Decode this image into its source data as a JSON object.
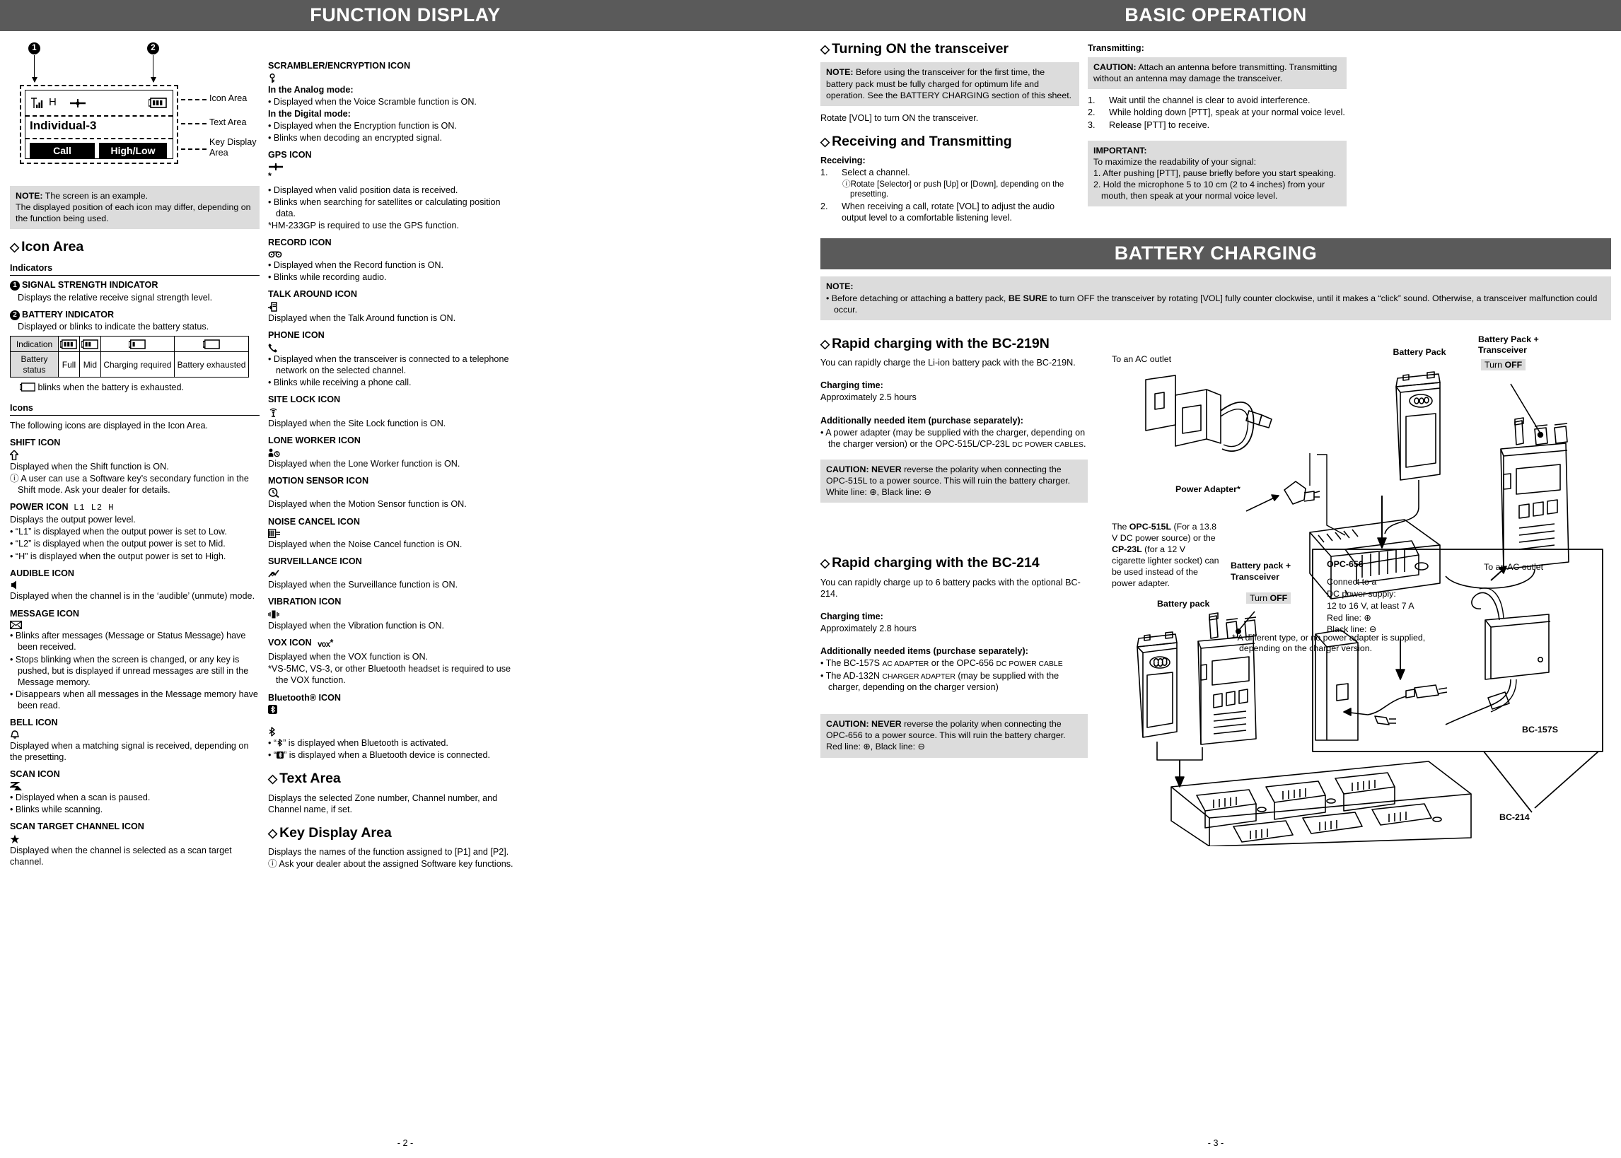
{
  "left_page": {
    "banner": "FUNCTION DISPLAY",
    "page_number": "- 2 -",
    "figure": {
      "callout_1": "1",
      "callout_2": "2",
      "lcd_power": "H",
      "lcd_text": "Individual-3",
      "key_left": "Call",
      "key_right": "High/Low",
      "label_icon_area": "Icon Area",
      "label_text_area": "Text Area",
      "label_key_area": "Key Display Area"
    },
    "figure_note": {
      "bold": "NOTE:",
      "line1": " The screen is an example.",
      "line2": "The displayed position of each icon may differ, depending on the function being used."
    },
    "icon_area": {
      "heading": "Icon Area",
      "indicators_heading": "Indicators",
      "indicator_1": {
        "num": "1",
        "title": "SIGNAL STRENGTH INDICATOR",
        "desc": "Displays the relative receive signal strength level."
      },
      "indicator_2": {
        "num": "2",
        "title": "BATTERY INDICATOR",
        "desc": "Displayed or blinks to indicate the battery status."
      },
      "battery_table": {
        "row1_header": "Indication",
        "row2_header": "Battery status",
        "statuses": [
          "Full",
          "Mid",
          "Charging required",
          "Battery exhausted"
        ]
      },
      "battery_note": "blinks when the battery is exhausted."
    },
    "icons_section": {
      "heading": "Icons",
      "intro": "The following icons are displayed in the Icon Area.",
      "items": [
        {
          "title": "SHIFT ICON",
          "lines": [
            "Displayed when the Shift function is ON."
          ],
          "info": "A user can use a Software key’s secondary function in the Shift mode. Ask your dealer for details."
        },
        {
          "title": "POWER ICON",
          "glyph_text": "L1 L2 H",
          "lines": [
            "Displays the output power level.",
            "• “L1” is displayed when the output power is set to Low.",
            "• “L2” is displayed when the output power is set to Mid.",
            "• “H” is displayed when the output power is set to High."
          ]
        },
        {
          "title": "AUDIBLE ICON",
          "lines": [
            "Displayed when the channel is in the ‘audible’ (unmute) mode."
          ]
        },
        {
          "title": "MESSAGE ICON",
          "lines": [
            "• Blinks after messages (Message or Status Message) have been received.",
            "• Stops blinking when the screen is changed, or any key is pushed, but is displayed if unread messages are still in the Message memory.",
            "• Disappears when all messages in the Message memory have been read."
          ]
        },
        {
          "title": "BELL ICON",
          "lines": [
            "Displayed when a matching signal is received, depending on the presetting."
          ]
        },
        {
          "title": "SCAN ICON",
          "lines": [
            "• Displayed when a scan is paused.",
            "• Blinks while scanning."
          ]
        },
        {
          "title": "SCAN TARGET CHANNEL ICON",
          "lines": [
            "Displayed when the channel is selected as a scan target channel."
          ]
        }
      ]
    },
    "col2_items": [
      {
        "title": "SCRAMBLER/ENCRYPTION ICON",
        "lines": [
          "B:In the Analog mode:",
          "• Displayed when the Voice Scramble function is ON.",
          "B:In the Digital mode:",
          "• Displayed when the Encryption function is ON.",
          "• Blinks when decoding an encrypted signal."
        ]
      },
      {
        "title": "GPS ICON",
        "star": "*",
        "lines": [
          "• Displayed when valid position data is received.",
          "• Blinks when searching for satellites or calculating position data.",
          "*HM-233GP is required to use the GPS function."
        ]
      },
      {
        "title": "RECORD ICON",
        "lines": [
          "• Displayed when the Record function is ON.",
          "• Blinks while recording audio."
        ]
      },
      {
        "title": "TALK AROUND ICON",
        "lines": [
          "Displayed when the Talk Around function is ON."
        ]
      },
      {
        "title": "PHONE ICON",
        "lines": [
          "• Displayed when the transceiver is connected to a telephone network on the selected channel.",
          "• Blinks while receiving a phone call."
        ]
      },
      {
        "title": "SITE LOCK ICON",
        "lines": [
          "Displayed when the Site Lock function is ON."
        ]
      },
      {
        "title": "LONE WORKER ICON",
        "lines": [
          "Displayed when the Lone Worker function is ON."
        ]
      },
      {
        "title": "MOTION SENSOR ICON",
        "lines": [
          "Displayed when the Motion Sensor function is ON."
        ]
      },
      {
        "title": "NOISE CANCEL ICON",
        "lines": [
          "Displayed when the Noise Cancel function is ON."
        ]
      },
      {
        "title": "SURVEILLANCE ICON",
        "lines": [
          "Displayed when the Surveillance function is ON."
        ]
      },
      {
        "title": "VIBRATION ICON",
        "lines": [
          "Displayed when the Vibration function is ON."
        ]
      },
      {
        "title": "VOX ICON",
        "star": "*",
        "lines": [
          "Displayed when the VOX function is ON.",
          "*VS-5MC, VS-3, or other Bluetooth headset is required to use the VOX function."
        ]
      },
      {
        "title": "Bluetooth® ICON",
        "lines": [
          "• “ ” is displayed when Bluetooth is activated.",
          "• “ ” is displayed when a Bluetooth device is connected."
        ]
      }
    ],
    "text_area": {
      "heading": "Text Area",
      "desc": "Displays the selected Zone number, Channel number, and Channel name, if set."
    },
    "key_display_area": {
      "heading": "Key Display Area",
      "desc": "Displays the names of the function assigned to [P1] and [P2].",
      "info": "Ask your dealer about the assigned Software key functions."
    }
  },
  "right_page": {
    "banner_basic": "BASIC OPERATION",
    "banner_battery": "BATTERY CHARGING",
    "page_number": "- 3 -",
    "turning_on": {
      "heading": "Turning ON the transceiver",
      "note_bold": "NOTE:",
      "note_text": " Before using the transceiver for the first time, the battery pack must be fully charged for optimum life and operation. See the BATTERY CHARGING section of this sheet.",
      "body": "Rotate [VOL] to turn ON the transceiver."
    },
    "receiving_transmitting": {
      "heading": "Receiving and Transmitting",
      "receiving_label": "Receiving:",
      "steps": [
        {
          "n": "1.",
          "text": "Select a channel."
        },
        {
          "n": "2.",
          "text": "When receiving a call, rotate [VOL] to adjust the audio output level to a comfortable listening level."
        }
      ],
      "step1_info": "Rotate [Selector] or push [Up] or [Down], depending on the presetting."
    },
    "transmitting": {
      "label": "Transmitting:",
      "caution_bold": "CAUTION:",
      "caution_text": " Attach an antenna before transmitting. Transmitting without an antenna may damage the transceiver.",
      "steps": [
        {
          "n": "1.",
          "text": "Wait until the channel is clear to avoid interference."
        },
        {
          "n": "2.",
          "text": "While holding down [PTT], speak at your normal voice level."
        },
        {
          "n": "3.",
          "text": "Release [PTT] to receive."
        }
      ],
      "important_title": "IMPORTANT:",
      "important_intro": "To maximize the readability of your signal:",
      "important_items": [
        "1. After pushing [PTT], pause briefly before you start speaking.",
        "2. Hold the microphone 5 to 10 cm (2 to 4 inches) from your mouth, then speak at your normal voice level."
      ]
    },
    "battery_note": {
      "title": "NOTE:",
      "text_a": "• Before detaching or attaching a battery pack, ",
      "text_b": "BE SURE",
      "text_c": " to turn OFF the transceiver by rotating [VOL] fully counter clockwise, until it makes a “click” sound. Otherwise, a transceiver malfunction could occur."
    },
    "bc219n": {
      "heading": "Rapid charging with the BC-219N",
      "body": "You can rapidly charge the Li-ion battery pack with the BC-219N.",
      "charging_time_label": "Charging time:",
      "charging_time": "Approximately 2.5 hours",
      "needed_label": "Additionally needed item (purchase separately):",
      "needed_text_1": "• A power adapter (may be supplied with the charger, depending on the charger version) or the OPC-515L/CP-23L ",
      "needed_text_2": "DC POWER CABLES",
      "needed_text_3": ".",
      "caution_bold": "CAUTION: NEVER",
      "caution_text": " reverse the polarity when connecting the OPC-515L to a power source. This will ruin the battery charger.",
      "polarity": "White line: ⊕, Black line: ⊖"
    },
    "bc219n_figure": {
      "ac_outlet": "To an AC outlet",
      "power_adapter": "Power Adapter*",
      "battery_pack": "Battery Pack",
      "battery_pack_transceiver": "Battery Pack + Transceiver",
      "turn_off_pre": "Turn ",
      "turn_off_bold": "OFF",
      "opc_note_1": "The ",
      "opc_note_b1": "OPC-515L",
      "opc_note_2": " (For a 13.8 V DC power source) or the ",
      "opc_note_b2": "CP-23L",
      "opc_note_3": " (for a 12 V cigarette lighter socket) can be used instead of the power adapter.",
      "footnote": "* A different type, or no power adapter is supplied, depending on the charger version."
    },
    "bc214": {
      "heading": "Rapid charging with the BC-214",
      "body": "You can rapidly charge up to 6 battery packs with the optional BC-214.",
      "charging_time_label": "Charging time:",
      "charging_time": "Approximately 2.8 hours",
      "needed_label": "Additionally needed items (purchase separately):",
      "item1_a": "• The BC-157S ",
      "item1_sc1": "AC ADAPTER",
      "item1_b": " or the OPC-656 ",
      "item1_sc2": "DC POWER CABLE",
      "item2_a": "• The AD-132N ",
      "item2_sc": "CHARGER ADAPTER",
      "item2_b": " (may be supplied with the charger, depending on the charger version)",
      "caution_bold": "CAUTION: NEVER",
      "caution_text": " reverse the polarity when connecting the OPC-656 to a power source. This will ruin the battery charger.",
      "polarity": "Red line: ⊕, Black line: ⊖"
    },
    "bc214_figure": {
      "battery_pack": "Battery pack",
      "battery_pack_transceiver": "Battery pack + Transceiver",
      "turn_off_pre": "Turn ",
      "turn_off_bold": "OFF",
      "opc656_title": "OPC-656",
      "opc656_l1": "Connect to a",
      "opc656_l2": "DC power supply:",
      "opc656_l3": "12 to 16 V, at least 7 A",
      "opc656_l4": "Red line:  ⊕",
      "opc656_l5": "Black line: ⊖",
      "ac_outlet": "To an AC outlet",
      "bc157s": "BC-157S",
      "bc214": "BC-214"
    }
  }
}
